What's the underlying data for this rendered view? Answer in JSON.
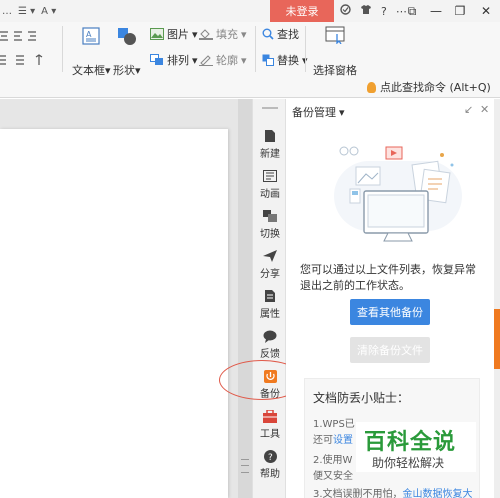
{
  "titlebar": {
    "left_fragments": [
      "…",
      "☰ ▾",
      "A ▾"
    ],
    "login_label": "未登录",
    "window_controls": [
      "⧉",
      "—",
      "❐",
      "✕"
    ]
  },
  "ribbon": {
    "textbox_label": "文本框",
    "textbox_arrow": "▾",
    "shape_label": "形状",
    "shape_arrow": "▾",
    "picture_label": "图片",
    "picture_arrow": "▾",
    "arrange_label": "排列",
    "arrange_arrow": "▾",
    "fill_label": "填充",
    "fill_arrow": "▾",
    "outline_label": "轮廓",
    "outline_arrow": "▾",
    "find_label": "查找",
    "replace_label": "替换",
    "replace_arrow": "▾",
    "select_pane_label": "选择窗格",
    "command_hint": "点此查找命令 (Alt+Q)"
  },
  "rail": {
    "items": [
      {
        "label": "新建",
        "icon": "new-doc-icon"
      },
      {
        "label": "动画",
        "icon": "animation-icon"
      },
      {
        "label": "切换",
        "icon": "transition-icon"
      },
      {
        "label": "分享",
        "icon": "share-icon"
      },
      {
        "label": "属性",
        "icon": "properties-icon"
      },
      {
        "label": "反馈",
        "icon": "feedback-icon"
      },
      {
        "label": "备份",
        "icon": "backup-icon"
      },
      {
        "label": "工具",
        "icon": "toolbox-icon"
      },
      {
        "label": "帮助",
        "icon": "help-icon"
      }
    ]
  },
  "panel": {
    "title": "备份管理",
    "title_arrow": "▾",
    "description": "您可以通过以上文件列表，恢复异常退出之前的工作状态。",
    "view_other_backups": "查看其他备份",
    "clear_backups": "清除备份文件",
    "tips": {
      "title": "文档防丢小贴士：",
      "line1": "1.WPS已",
      "line2_prefix": "还可",
      "line2_link": "设置",
      "line3": "2.使用W",
      "line4": "便又安全",
      "line5": "3.文档误删不用怕，",
      "line5_link": "金山数据恢复大"
    }
  },
  "watermark": {
    "big": "百科全说",
    "small": "助你轻松解决"
  },
  "colors": {
    "login_bg": "#e8665a",
    "primary_button": "#3b86e0",
    "highlight_ring": "#e05a4a",
    "watermark_green": "#2a9a3a",
    "scroll_accent": "#f07a20"
  }
}
